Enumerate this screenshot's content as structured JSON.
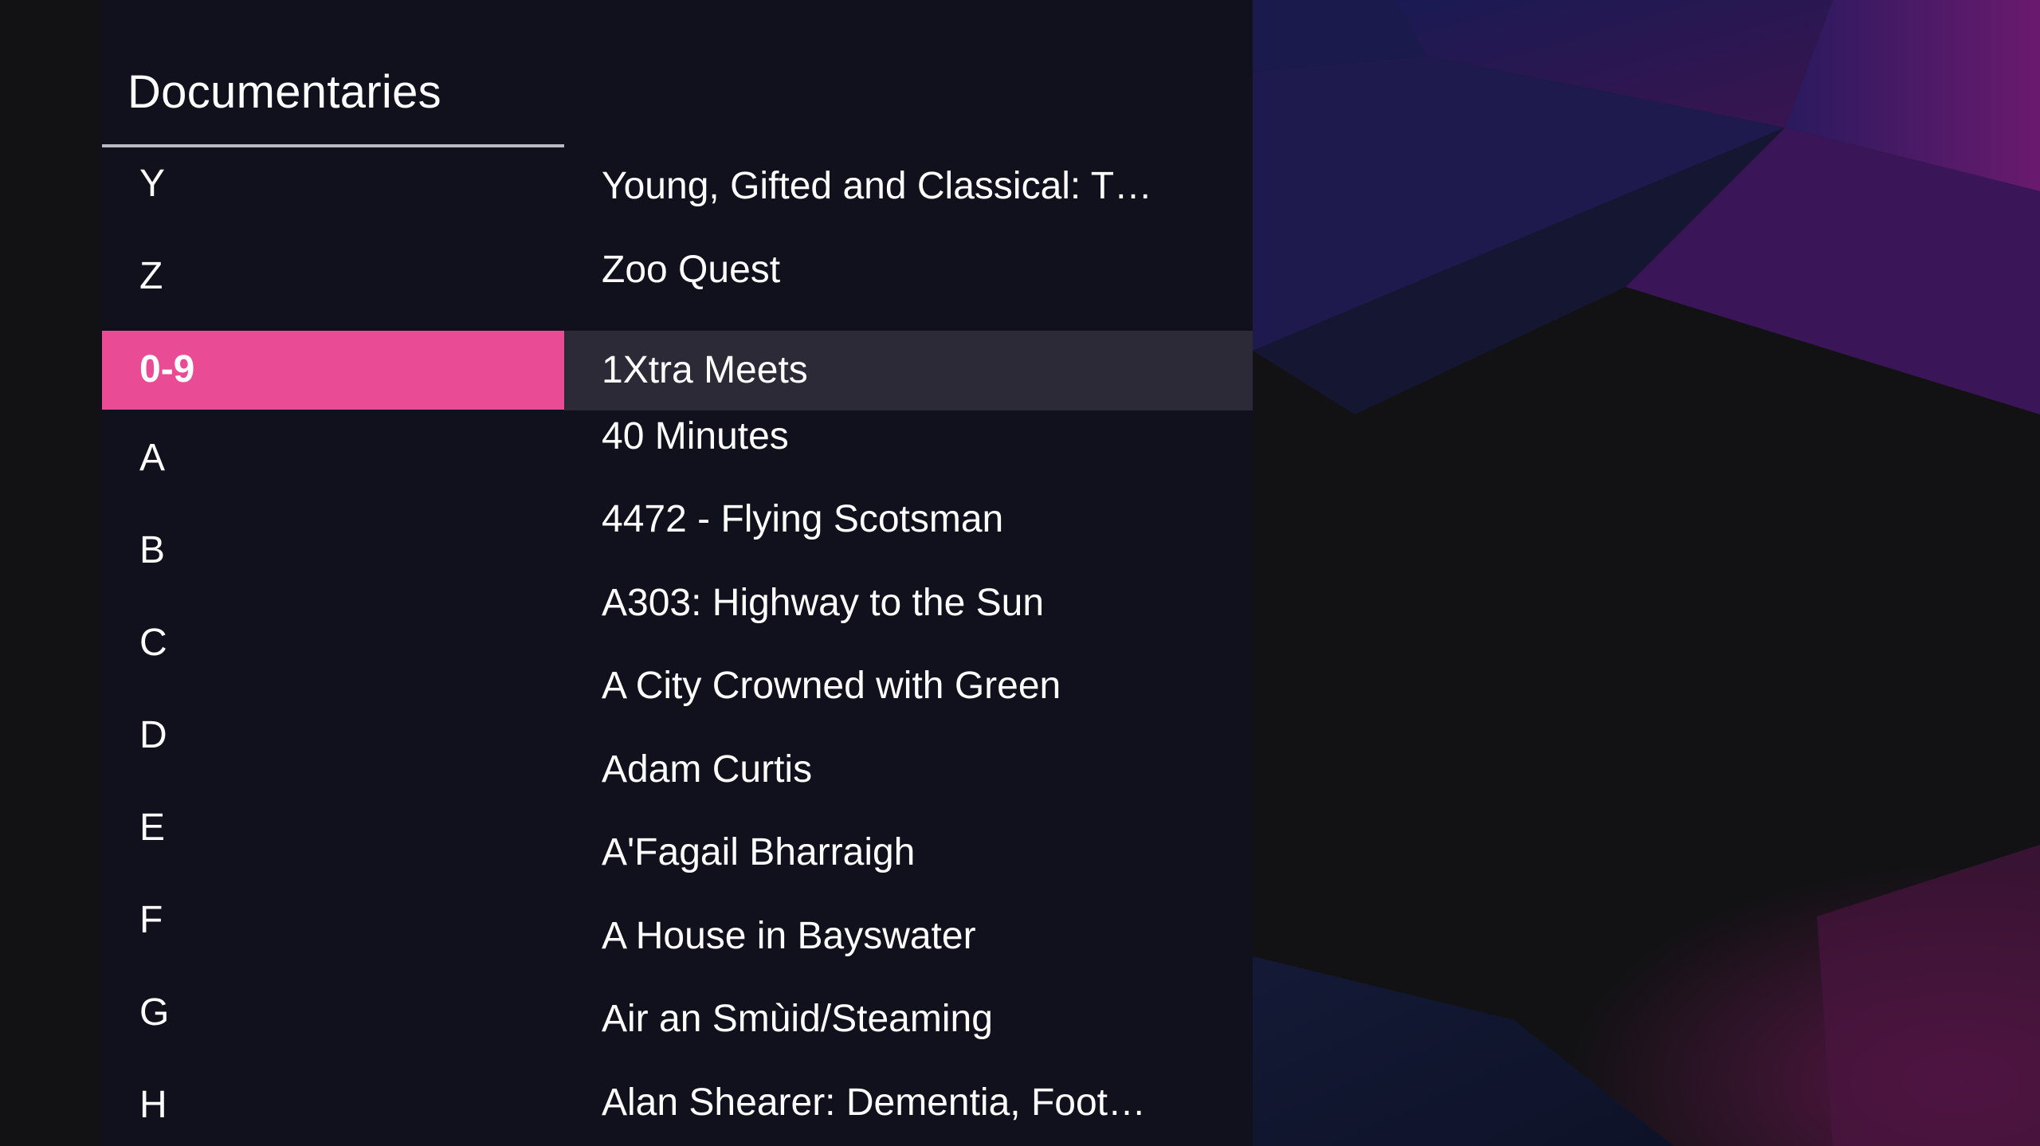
{
  "section": {
    "title": "Documentaries"
  },
  "letters": [
    {
      "label": "Y"
    },
    {
      "label": "Z"
    },
    {
      "label": "0-9",
      "selected": true
    },
    {
      "label": "A"
    },
    {
      "label": "B"
    },
    {
      "label": "C"
    },
    {
      "label": "D"
    },
    {
      "label": "E"
    },
    {
      "label": "F"
    },
    {
      "label": "G"
    },
    {
      "label": "H"
    }
  ],
  "titles": [
    {
      "label": "Young, Gifted and Classical: T…"
    },
    {
      "label": "Zoo Quest"
    },
    {
      "label": "1Xtra Meets",
      "selected": true
    },
    {
      "label": "40 Minutes"
    },
    {
      "label": "4472 - Flying Scotsman"
    },
    {
      "label": "A303: Highway to the Sun"
    },
    {
      "label": "A City Crowned with Green"
    },
    {
      "label": "Adam Curtis"
    },
    {
      "label": "A'Fagail Bharraigh"
    },
    {
      "label": "A House in Bayswater"
    },
    {
      "label": "Air an Smùid/Steaming"
    },
    {
      "label": "Alan Shearer: Dementia, Foot…"
    }
  ],
  "colors": {
    "accent": "#e94b95",
    "panel": "#11111d",
    "row_highlight": "#2b2a36"
  }
}
